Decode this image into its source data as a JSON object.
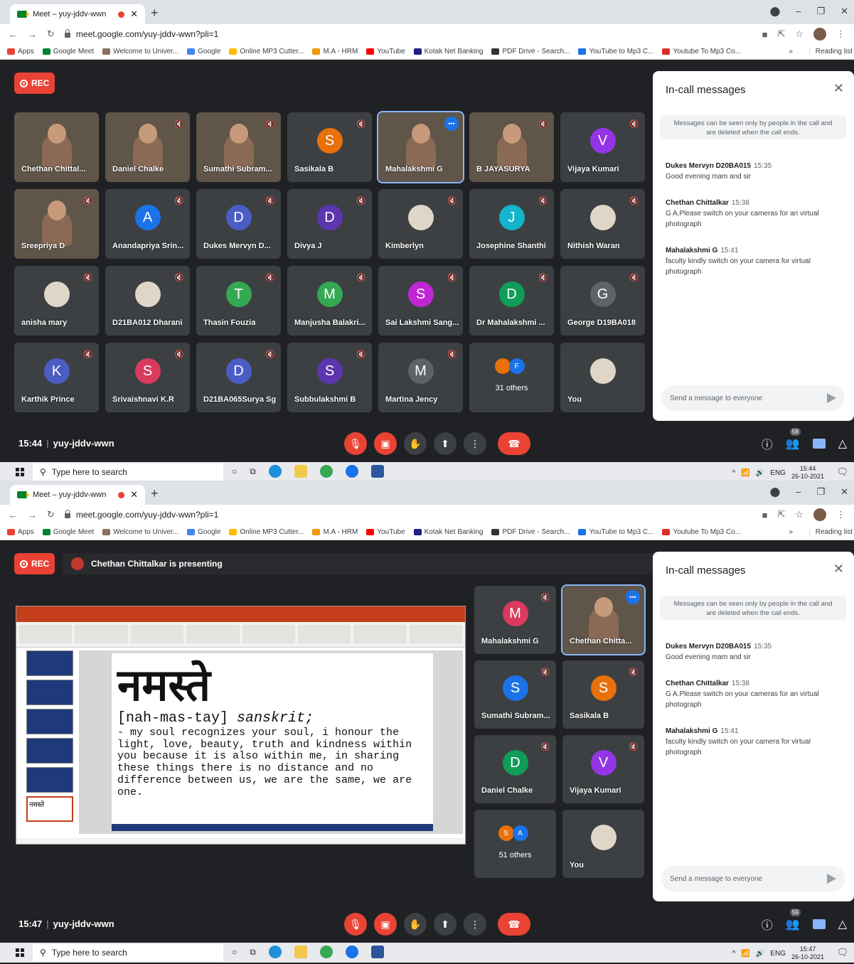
{
  "colors": {
    "meet_bg": "#202124",
    "tile": "#3c4043",
    "red": "#ea4335",
    "blue": "#1a73e8"
  },
  "browser": {
    "tab_title": "Meet – yuy-jddv-wwn",
    "url": "meet.google.com/yuy-jddv-wwn?pli=1",
    "bookmarks": [
      "Apps",
      "Google Meet",
      "Welcome to Univer...",
      "Google",
      "Online MP3 Cutter...",
      "M.A - HRM",
      "YouTube",
      "Kotak Net Banking",
      "PDF Drive - Search...",
      "YouTube to Mp3 C...",
      "Youtube To Mp3 Co..."
    ],
    "more": "»",
    "reading_list": "Reading list"
  },
  "rec_label": "REC",
  "panel": {
    "title": "In-call messages",
    "notice": "Messages can be seen only by people in the call and are deleted when the call ends.",
    "messages": [
      {
        "sender": "Dukes Mervyn D20BA015",
        "time": "15:35",
        "text": "Good evening  mam and sir"
      },
      {
        "sender": "Chethan Chittalkar",
        "time": "15:38",
        "text": "G A.Please switch on your cameras for an virtual photograph"
      },
      {
        "sender": "Mahalakshmi G",
        "time": "15:41",
        "text": "faculty kindly switch on your camera for virtual photograph"
      }
    ],
    "send_placeholder": "Send a message to everyone"
  },
  "shot1": {
    "time": "15:44",
    "code": "yuy-jddv-wwn",
    "people_count": "58",
    "tiles": [
      {
        "name": "Chethan Chittal...",
        "type": "video"
      },
      {
        "name": "Daniel Chalke",
        "type": "video"
      },
      {
        "name": "Sumathi Subram...",
        "type": "video"
      },
      {
        "name": "Sasikala B",
        "initial": "S",
        "color": "#e8710a"
      },
      {
        "name": "Mahalakshmi G",
        "type": "video",
        "active": true
      },
      {
        "name": "B JAYASURYA",
        "type": "video"
      },
      {
        "name": "Vijaya Kumari",
        "initial": "V",
        "color": "#9334e6"
      },
      {
        "name": "Sreepriya D",
        "type": "video"
      },
      {
        "name": "Anandapriya Srin...",
        "initial": "A",
        "color": "#1a73e8"
      },
      {
        "name": "Dukes Mervyn D...",
        "initial": "D",
        "color": "#4b5cc4"
      },
      {
        "name": "Divya J",
        "initial": "D",
        "color": "#5e35b1"
      },
      {
        "name": "Kimberlyn",
        "type": "img"
      },
      {
        "name": "Josephine Shanthi",
        "initial": "J",
        "color": "#12b5cb"
      },
      {
        "name": "Nithish Waran",
        "type": "img"
      },
      {
        "name": "anisha mary",
        "type": "img"
      },
      {
        "name": "D21BA012 Dharani",
        "type": "img"
      },
      {
        "name": "Thasin Fouzia",
        "initial": "T",
        "color": "#34a853"
      },
      {
        "name": "Manjusha Balakri...",
        "initial": "M",
        "color": "#34a853"
      },
      {
        "name": "Sai Lakshmi Sang...",
        "initial": "S",
        "color": "#c026d3"
      },
      {
        "name": "Dr Mahalakshmi ...",
        "initial": "D",
        "color": "#0f9d58"
      },
      {
        "name": "George D19BA018",
        "initial": "G",
        "color": "#5f6368"
      },
      {
        "name": "Karthik Prince",
        "initial": "K",
        "color": "#4b5cc4"
      },
      {
        "name": "Srivaishnavi K.R",
        "initial": "S",
        "color": "#d93a5e"
      },
      {
        "name": "D21BA065Surya Sg",
        "initial": "D",
        "color": "#4b5cc4"
      },
      {
        "name": "Subbulakshmi B",
        "initial": "S",
        "color": "#5e35b1"
      },
      {
        "name": "Martina Jency",
        "initial": "M",
        "color": "#5f6368"
      },
      {
        "name": "31 others",
        "type": "others",
        "mini": [
          "",
          "F"
        ]
      },
      {
        "name": "You",
        "type": "img"
      }
    ]
  },
  "shot2": {
    "time": "15:47",
    "code": "yuy-jddv-wwn",
    "people_count": "59",
    "presenting": "Chethan Chittalkar is presenting",
    "slide": {
      "word": "नमस्ते",
      "pron": "[nah-mas-tay]",
      "pron_lang": "sanskrit;",
      "meaning": "- my soul recognizes your soul, i honour the light, love, beauty, truth and kindness within you because it is also within me, in sharing these things there is no distance and no difference between us, we are the same, we are one.",
      "thumb_label": "नमस्ते"
    },
    "tiles": [
      {
        "name": "Mahalakshmi G",
        "initial": "M",
        "color": "#d93a5e"
      },
      {
        "name": "Chethan Chitta...",
        "type": "video",
        "active": true
      },
      {
        "name": "Sumathi Subram...",
        "initial": "S",
        "color": "#1a73e8"
      },
      {
        "name": "Sasikala B",
        "initial": "S",
        "color": "#e8710a"
      },
      {
        "name": "Daniel Chalke",
        "initial": "D",
        "color": "#0f9d58"
      },
      {
        "name": "Vijaya Kumari",
        "initial": "V",
        "color": "#9334e6"
      },
      {
        "name": "51 others",
        "type": "others",
        "mini": [
          "S",
          "A"
        ]
      },
      {
        "name": "You",
        "type": "img"
      }
    ]
  },
  "taskbar": {
    "search": "Type here to search",
    "lang": "ENG",
    "date": "26-10-2021",
    "time1": "15:44",
    "time2": "15:47"
  }
}
